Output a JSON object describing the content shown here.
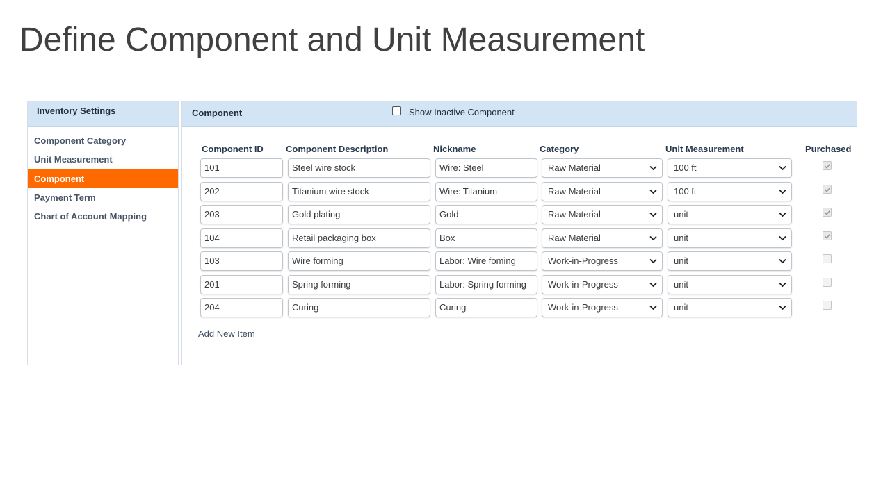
{
  "slide_title": "Define Component and Unit Measurement",
  "sidebar": {
    "title": "Inventory Settings",
    "items": [
      {
        "label": "Component Category",
        "active": false
      },
      {
        "label": "Unit Measurement",
        "active": false
      },
      {
        "label": "Component",
        "active": true
      },
      {
        "label": "Payment Term",
        "active": false
      },
      {
        "label": "Chart of Account Mapping",
        "active": false
      }
    ]
  },
  "panel": {
    "title": "Component",
    "show_inactive_label": "Show Inactive Component",
    "show_inactive_checked": false,
    "columns": {
      "id": "Component ID",
      "description": "Component Description",
      "nickname": "Nickname",
      "category": "Category",
      "unit": "Unit Measurement",
      "purchased": "Purchased"
    },
    "rows": [
      {
        "id": "101",
        "description": "Steel wire stock",
        "nickname": "Wire: Steel",
        "category": "Raw Material",
        "unit": "100 ft",
        "purchased": true
      },
      {
        "id": "202",
        "description": "Titanium wire stock",
        "nickname": "Wire: Titanium",
        "category": "Raw Material",
        "unit": "100 ft",
        "purchased": true
      },
      {
        "id": "203",
        "description": "Gold plating",
        "nickname": "Gold",
        "category": "Raw Material",
        "unit": "unit",
        "purchased": true
      },
      {
        "id": "104",
        "description": "Retail packaging box",
        "nickname": "Box",
        "category": "Raw Material",
        "unit": "unit",
        "purchased": true
      },
      {
        "id": "103",
        "description": "Wire forming",
        "nickname": "Labor: Wire foming",
        "category": "Work-in-Progress",
        "unit": "unit",
        "purchased": false
      },
      {
        "id": "201",
        "description": "Spring forming",
        "nickname": "Labor: Spring forming",
        "category": "Work-in-Progress",
        "unit": "unit",
        "purchased": false
      },
      {
        "id": "204",
        "description": "Curing",
        "nickname": "Curing",
        "category": "Work-in-Progress",
        "unit": "unit",
        "purchased": false
      }
    ],
    "add_new_label": "Add New Item"
  },
  "colors": {
    "header_bg": "#d3e5f4",
    "active_item_bg": "#ff6a00",
    "title_text": "#404040"
  }
}
